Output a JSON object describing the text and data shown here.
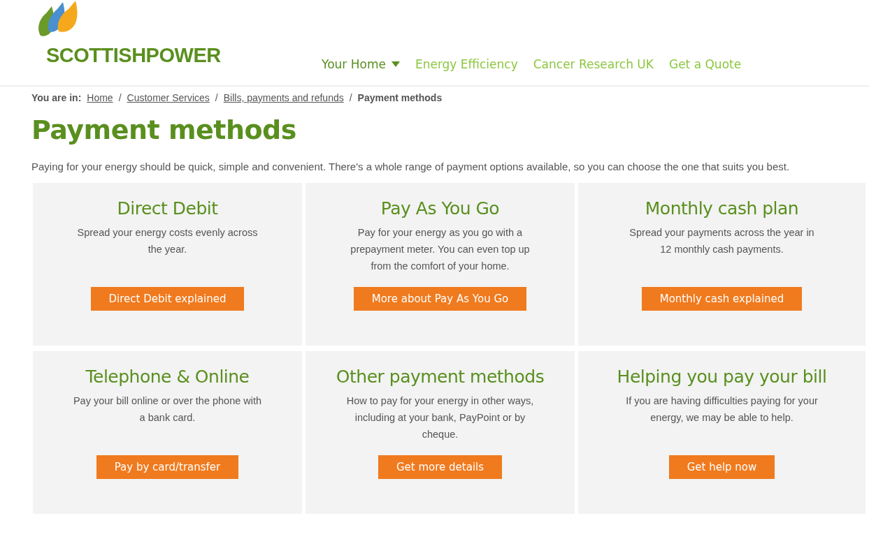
{
  "logo": {
    "wordmark": "SCOTTISHPOWER"
  },
  "nav": [
    {
      "label": "Your Home",
      "selected": true,
      "dropdown": true
    },
    {
      "label": "Energy Efficiency",
      "selected": false,
      "dropdown": false
    },
    {
      "label": "Cancer Research UK",
      "selected": false,
      "dropdown": false
    },
    {
      "label": "Get a Quote",
      "selected": false,
      "dropdown": false
    }
  ],
  "breadcrumb": {
    "label": "You are in:",
    "items": [
      {
        "text": "Home",
        "current": false
      },
      {
        "separator": "/",
        "text": "Customer Services",
        "current": false
      },
      {
        "separator": "/",
        "text": "Bills, payments and refunds",
        "current": false
      },
      {
        "separator": "/",
        "text": "Payment methods",
        "current": true
      }
    ]
  },
  "title": "Payment methods",
  "intro": "Paying for your energy should be quick, simple and convenient. There's a whole range of payment options available, so you can choose the one that suits you best.",
  "cards": [
    {
      "title": "Direct Debit",
      "text": "Spread your energy costs evenly across the year.",
      "button": "Direct Debit explained"
    },
    {
      "title": "Pay As You Go",
      "text": "Pay for your energy as you go with a prepayment meter. You can even top up from the comfort of your home.",
      "button": "More about Pay As You Go"
    },
    {
      "title": "Monthly cash plan",
      "text": "Spread your payments across the year in 12 monthly cash payments.",
      "button": "Monthly cash explained"
    },
    {
      "title": "Telephone & Online",
      "text": "Pay your bill online or over the phone with a bank card.",
      "button": "Pay by card/transfer"
    },
    {
      "title": "Other payment methods",
      "text": "How to pay for your energy in other ways, including at your bank, PayPoint or by cheque.",
      "button": "Get more details"
    },
    {
      "title": "Helping you pay your bill",
      "text": "If you are having difficulties paying for your energy, we may be able to help.",
      "button": "Get help now"
    }
  ]
}
